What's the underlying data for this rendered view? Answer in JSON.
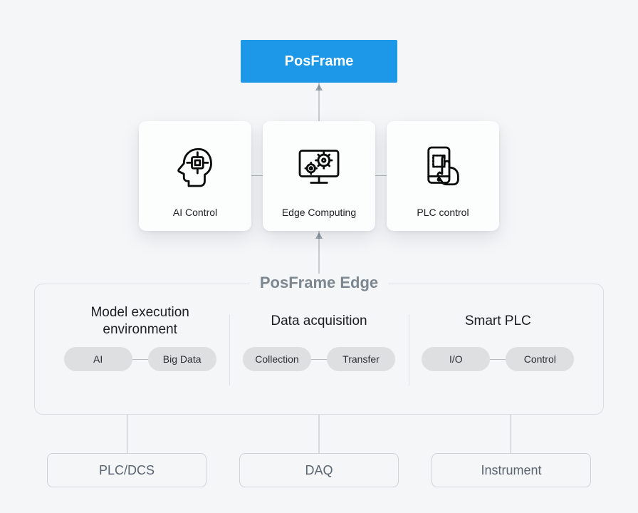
{
  "top": {
    "title": "PosFrame"
  },
  "cards": [
    {
      "label": "AI Control",
      "icon": "head-chip-icon"
    },
    {
      "label": "Edge Computing",
      "icon": "computer-gears-icon"
    },
    {
      "label": "PLC control",
      "icon": "phone-touch-icon"
    }
  ],
  "edge": {
    "title": "PosFrame Edge",
    "columns": [
      {
        "heading": "Model execution environment",
        "pills": [
          "AI",
          "Big Data"
        ]
      },
      {
        "heading": "Data acquisition",
        "pills": [
          "Collection",
          "Transfer"
        ]
      },
      {
        "heading": "Smart PLC",
        "pills": [
          "I/O",
          "Control"
        ]
      }
    ]
  },
  "bottom": [
    "PLC/DCS",
    "DAQ",
    "Instrument"
  ],
  "colors": {
    "accent": "#1d97e8"
  }
}
